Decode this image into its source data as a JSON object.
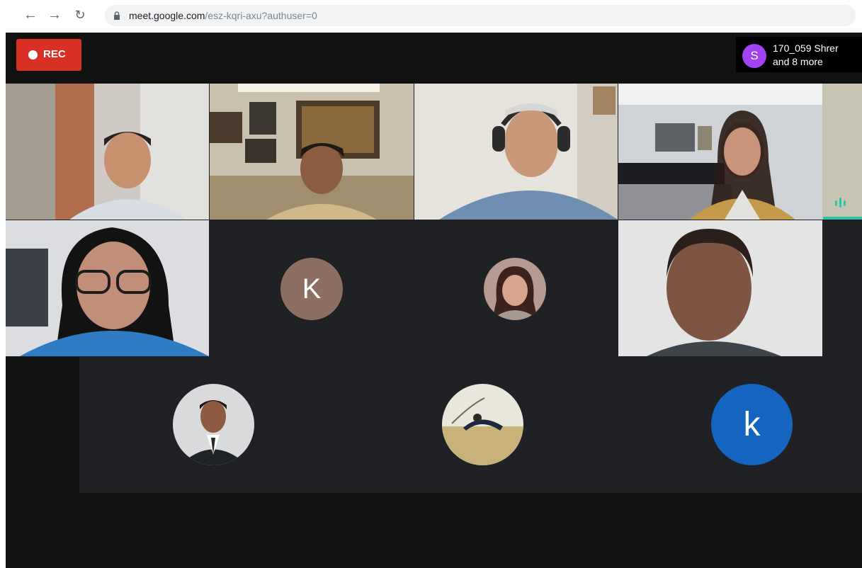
{
  "browser": {
    "back_icon": "arrow-left-icon",
    "forward_icon": "arrow-right-icon",
    "reload_icon": "reload-icon",
    "url_host": "meet.google.com",
    "url_path": "/esz-kqri-axu?authuser=0"
  },
  "meet": {
    "rec_label": "REC",
    "presenter": {
      "initial": "S",
      "name_line1": "170_059 Shrer",
      "name_line2": "and 8 more",
      "avatar_color": "#a142f4"
    },
    "participants": {
      "k_upper": {
        "initial": "K",
        "color": "#8d6e63"
      },
      "k_lower": {
        "initial": "k",
        "color": "#1565c0"
      }
    },
    "colors": {
      "rec": "#d93025",
      "stage": "#202124",
      "speaking": "#2ec4a6"
    }
  }
}
